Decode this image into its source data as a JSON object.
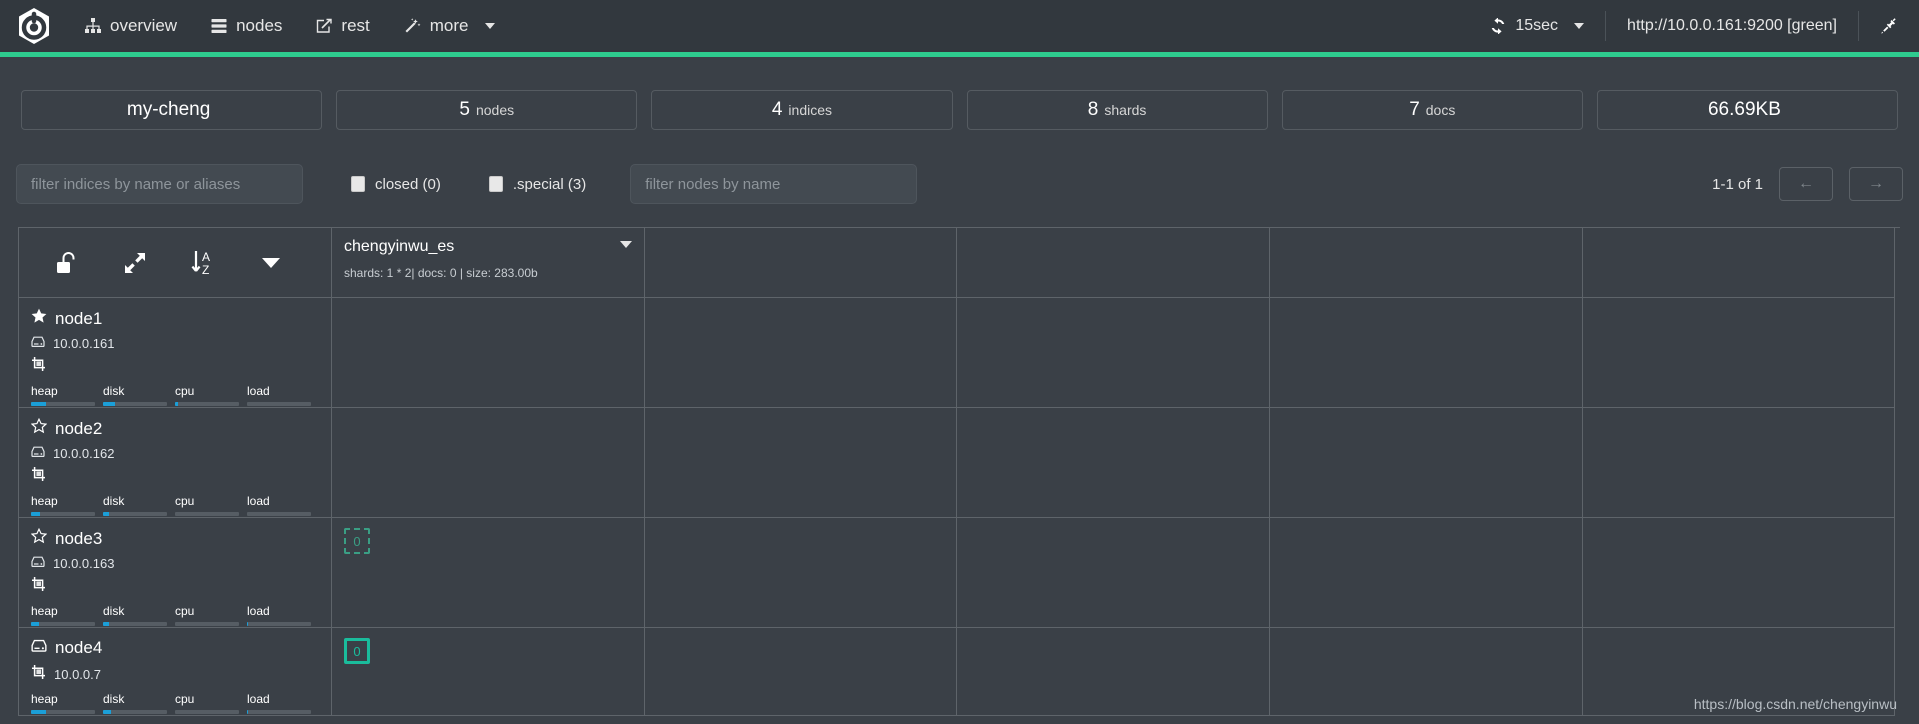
{
  "navbar": {
    "logo_icon": "cerebro-hexagon-logo",
    "items": [
      {
        "label": "overview",
        "icon": "sitemap-icon"
      },
      {
        "label": "nodes",
        "icon": "server-list-icon"
      },
      {
        "label": "rest",
        "icon": "edit-square-icon"
      },
      {
        "label": "more",
        "icon": "magic-wand-icon",
        "has_caret": true
      }
    ],
    "refresh": {
      "label": "15sec",
      "icon": "refresh-icon",
      "has_caret": true
    },
    "cluster_url": "http://10.0.0.161:9200 [green]",
    "disconnect_icon": "plug-disconnect-icon",
    "accent_color": "#2ecc8f"
  },
  "stats": [
    {
      "value": "my-cheng",
      "unit": ""
    },
    {
      "value": "5",
      "unit": "nodes"
    },
    {
      "value": "4",
      "unit": "indices"
    },
    {
      "value": "8",
      "unit": "shards"
    },
    {
      "value": "7",
      "unit": "docs"
    },
    {
      "value": "66.69KB",
      "unit": ""
    }
  ],
  "filters": {
    "indices_placeholder": "filter indices by name or aliases",
    "indices_value": "",
    "nodes_placeholder": "filter nodes by name",
    "nodes_value": "",
    "checkboxes": [
      {
        "label": "closed (0)",
        "checked": false
      },
      {
        "label": ".special (3)",
        "checked": false
      }
    ],
    "pager": {
      "range_label": "1-1 of 1",
      "prev_label": "←",
      "next_label": "→"
    }
  },
  "table": {
    "controls": [
      {
        "icon": "unlock-icon",
        "name": "toggle-index-lock"
      },
      {
        "icon": "expand-arrows-icon",
        "name": "toggle-expand"
      },
      {
        "icon": "sort-alpha-asc-icon",
        "name": "sort-alphabetical"
      },
      {
        "icon": "caret-down-icon",
        "name": "index-actions-menu"
      }
    ],
    "indices": [
      {
        "name": "chengyinwu_es",
        "meta": "shards: 1 * 2| docs: 0 | size: 283.00b",
        "caret_icon": "caret-down-icon"
      }
    ],
    "empty_columns": 4,
    "nodes": [
      {
        "name": "node1",
        "role_icon": "star-filled-icon",
        "host": "10.0.0.161",
        "host_icon": "hdd-icon",
        "extra_icons": [
          "shard-transform-icon"
        ],
        "ip_inline": false,
        "bars": [
          {
            "label": "heap",
            "pct": 24
          },
          {
            "label": "disk",
            "pct": 18
          },
          {
            "label": "cpu",
            "pct": 4
          },
          {
            "label": "load",
            "pct": 0
          }
        ],
        "shards": []
      },
      {
        "name": "node2",
        "role_icon": "star-outline-icon",
        "host": "10.0.0.162",
        "host_icon": "hdd-icon",
        "extra_icons": [
          "shard-transform-icon"
        ],
        "ip_inline": false,
        "bars": [
          {
            "label": "heap",
            "pct": 14
          },
          {
            "label": "disk",
            "pct": 10
          },
          {
            "label": "cpu",
            "pct": 0
          },
          {
            "label": "load",
            "pct": 0
          }
        ],
        "shards": []
      },
      {
        "name": "node3",
        "role_icon": "star-outline-icon",
        "host": "10.0.0.163",
        "host_icon": "hdd-icon",
        "extra_icons": [
          "shard-transform-icon"
        ],
        "ip_inline": false,
        "bars": [
          {
            "label": "heap",
            "pct": 12
          },
          {
            "label": "disk",
            "pct": 9
          },
          {
            "label": "cpu",
            "pct": 0
          },
          {
            "label": "load",
            "pct": 2
          }
        ],
        "shards": [
          {
            "label": "0",
            "type": "replica"
          }
        ]
      },
      {
        "name": "node4",
        "role_icon": "hdd-icon",
        "host": "10.0.0.7",
        "host_icon": "shard-transform-icon",
        "extra_icons": [],
        "ip_inline": true,
        "bars": [
          {
            "label": "heap",
            "pct": 24
          },
          {
            "label": "disk",
            "pct": 12
          },
          {
            "label": "cpu",
            "pct": 0
          },
          {
            "label": "load",
            "pct": 2
          }
        ],
        "shards": [
          {
            "label": "0",
            "type": "primary"
          }
        ]
      }
    ]
  },
  "watermark": "https://blog.csdn.net/chengyinwu",
  "colors": {
    "accent_green": "#2ecc8f",
    "shard_primary": "#1abc9c",
    "shard_replica": "#3a9e84",
    "bar_blue": "#1b9fd8",
    "background": "#3a4047",
    "navbar": "#32383e"
  }
}
